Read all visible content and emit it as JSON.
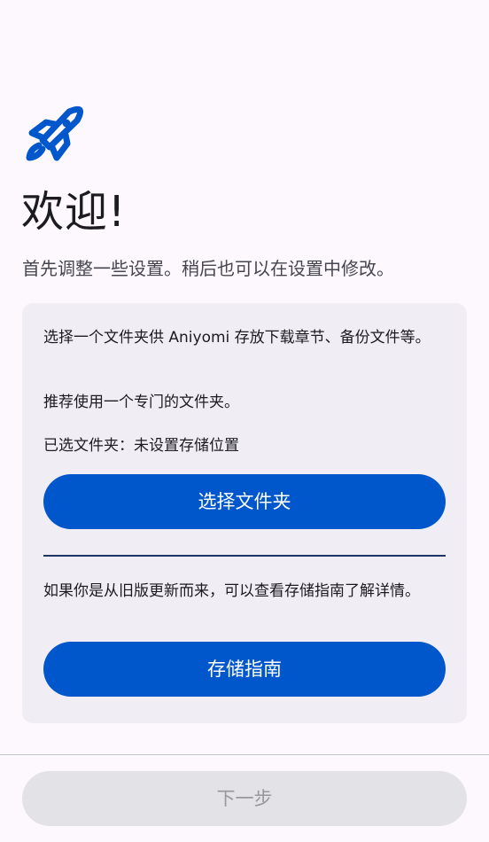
{
  "header": {
    "icon": "rocket-icon",
    "title": "欢迎!",
    "subtitle": "首先调整一些设置。稍后也可以在设置中修改。"
  },
  "storage_card": {
    "description": "选择一个文件夹供 Aniyomi 存放下载章节、备份文件等。",
    "recommendation": "推荐使用一个专门的文件夹。",
    "selected_folder": "已选文件夹：未设置存储位置",
    "pick_folder_label": "选择文件夹",
    "upgrade_note": "如果你是从旧版更新而来，可以查看存储指南了解详情。",
    "storage_guide_label": "存储指南"
  },
  "footer": {
    "next_label": "下一步"
  },
  "colors": {
    "accent": "#0057cb",
    "card_background": "#f1edf5",
    "page_background": "#fdf8fd",
    "disabled_button": "#e3e2e7"
  }
}
